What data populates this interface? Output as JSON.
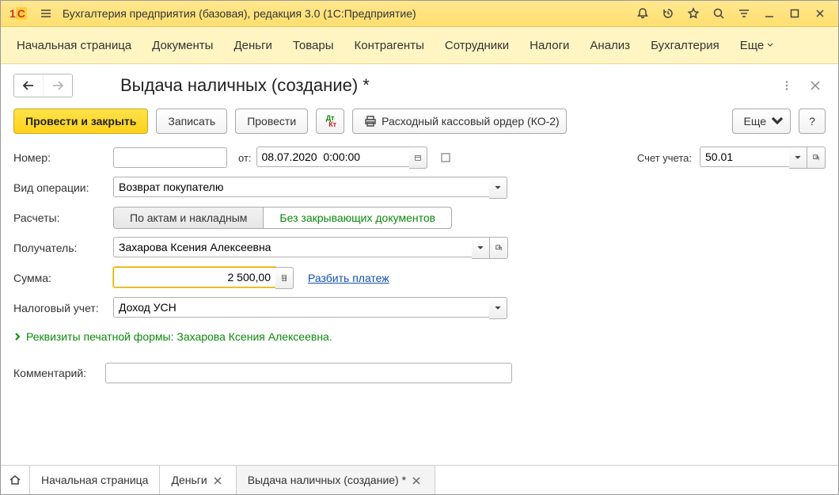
{
  "titlebar": {
    "title": "Бухгалтерия предприятия (базовая), редакция 3.0  (1С:Предприятие)"
  },
  "menu": {
    "items": [
      "Начальная страница",
      "Документы",
      "Деньги",
      "Товары",
      "Контрагенты",
      "Сотрудники",
      "Налоги",
      "Анализ",
      "Бухгалтерия"
    ],
    "more": "Еще"
  },
  "doc": {
    "title": "Выдача наличных (создание) *"
  },
  "toolbar": {
    "post_close": "Провести и закрыть",
    "save": "Записать",
    "post": "Провести",
    "print_form": "Расходный кассовый ордер (КО-2)",
    "more": "Еще",
    "help": "?"
  },
  "form": {
    "number_label": "Номер:",
    "number_value": "",
    "from_label": "от:",
    "date_value": "08.07.2020  0:00:00",
    "account_label": "Счет учета:",
    "account_value": "50.01",
    "optype_label": "Вид операции:",
    "optype_value": "Возврат покупателю",
    "calc_label": "Расчеты:",
    "calc_opt1": "По актам и накладным",
    "calc_opt2": "Без закрывающих документов",
    "recipient_label": "Получатель:",
    "recipient_value": "Захарова Ксения Алексеевна",
    "sum_label": "Сумма:",
    "sum_value": "2 500,00",
    "split_link": "Разбить платеж",
    "tax_label": "Налоговый учет:",
    "tax_value": "Доход УСН",
    "printform_expand": "Реквизиты печатной формы: Захарова Ксения Алексеевна.",
    "comment_label": "Комментарий:",
    "comment_value": ""
  },
  "tabs": {
    "home": "Начальная страница",
    "t1": "Деньги",
    "t2": "Выдача наличных (создание) *"
  }
}
